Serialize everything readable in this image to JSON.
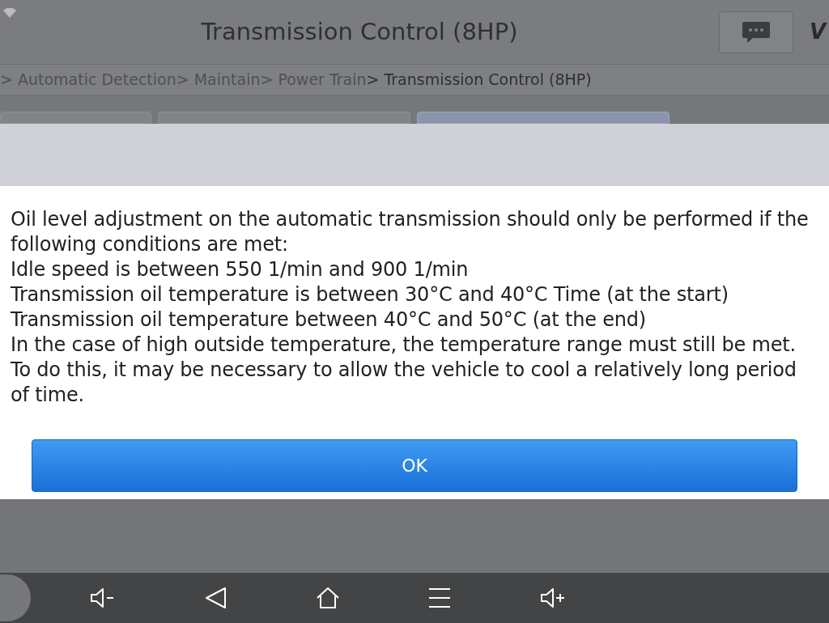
{
  "header": {
    "title": "Transmission Control (8HP)",
    "logo": "V"
  },
  "breadcrumb": [
    {
      "label": "> Automatic Detection",
      "current": false
    },
    {
      "label": "> Maintain",
      "current": false
    },
    {
      "label": "> Power Train",
      "current": false
    },
    {
      "label": "> Transmission Control (8HP)",
      "current": true
    }
  ],
  "tabs": [
    {
      "selected": false
    },
    {
      "selected": false
    },
    {
      "selected": true
    }
  ],
  "dialog": {
    "lines": [
      "Oil level adjustment on the automatic transmission should only be performed if the following conditions are met:",
      "Idle speed is between 550 1/min and 900 1/min",
      "Transmission oil temperature is between 30°C and 40°C Time (at the start)",
      "Transmission oil temperature between 40°C and 50°C (at the end)",
      "In the case of high outside temperature, the temperature range must still be met.",
      "To do this, it may be necessary to allow the vehicle to cool a relatively long period of time."
    ],
    "button": "OK"
  },
  "nav_bar": [
    {
      "kind": "volume-down"
    },
    {
      "kind": "back"
    },
    {
      "kind": "home"
    },
    {
      "kind": "menu"
    },
    {
      "kind": "volume-up"
    }
  ]
}
